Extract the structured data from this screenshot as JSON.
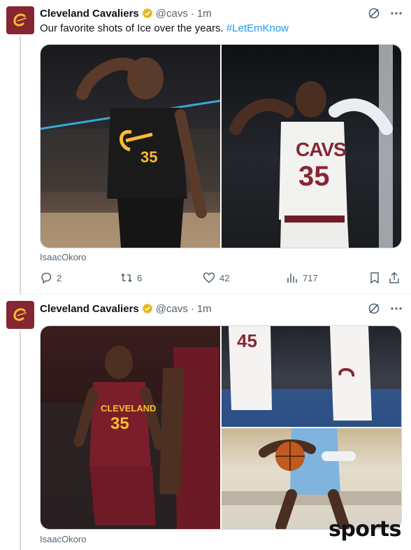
{
  "colors": {
    "brand": "#862633",
    "gold": "#fdbb30",
    "link": "#1d9bf0",
    "muted": "#536471"
  },
  "tweets": [
    {
      "account_name": "Cleveland Cavaliers",
      "handle": "@cavs",
      "separator": "·",
      "time": "1m",
      "text": "Our favorite shots of Ice over the years.",
      "hashtag": "#LetEmKnow",
      "credit": "IsaacOkoro",
      "stats": {
        "replies": "2",
        "reposts": "6",
        "likes": "42",
        "views": "717"
      }
    },
    {
      "account_name": "Cleveland Cavaliers",
      "handle": "@cavs",
      "separator": "·",
      "time": "1m",
      "credit": "IsaacOkoro",
      "jersey_text": "CLEVELAND"
    }
  ],
  "photo_texts": {
    "jersey_cavs": "CAVS",
    "jersey_number": "35",
    "jersey_45": "45"
  },
  "watermark": "sports",
  "icons": [
    "cavs-logo-icon",
    "verified-badge-icon",
    "grok-icon",
    "more-icon",
    "reply-icon",
    "repost-icon",
    "like-icon",
    "views-icon",
    "bookmark-icon",
    "share-icon"
  ]
}
